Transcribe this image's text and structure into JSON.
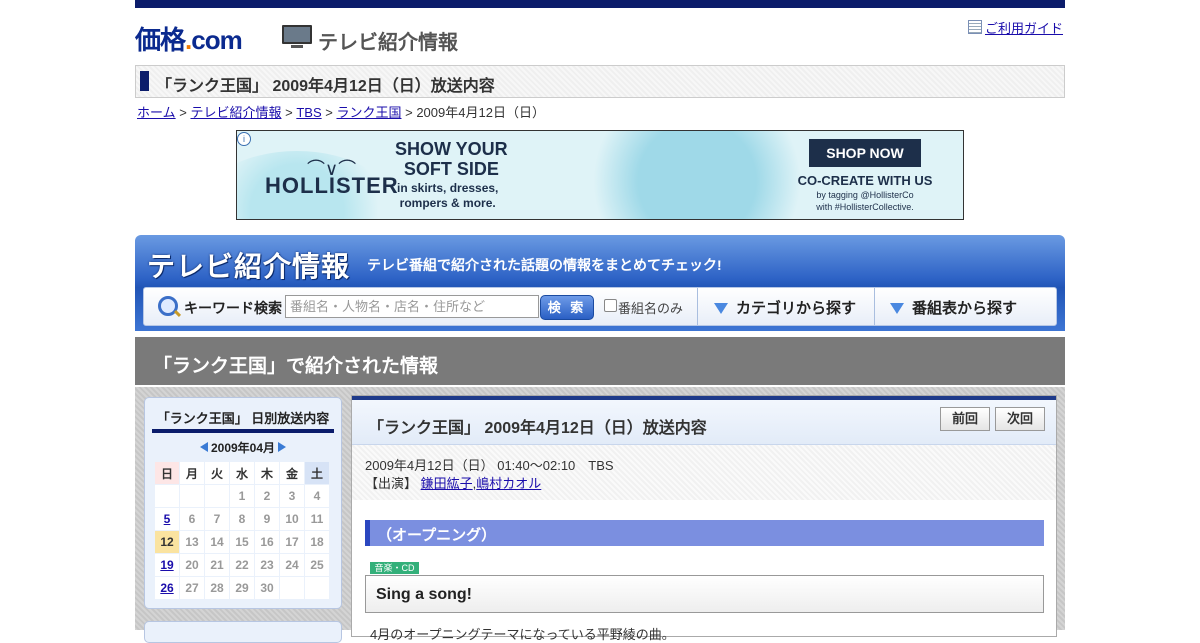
{
  "header": {
    "logo_main": "価格",
    "logo_dot": ".",
    "logo_com": "com",
    "section_title": "テレビ紹介情報",
    "guide_link": "ご利用ガイド"
  },
  "page_title": "「ランク王国」 2009年4月12日（日）放送内容",
  "breadcrumb": [
    {
      "label": "ホーム",
      "link": true
    },
    {
      "label": "テレビ紹介情報",
      "link": true
    },
    {
      "label": "TBS",
      "link": true
    },
    {
      "label": "ランク王国",
      "link": true
    },
    {
      "label": "2009年4月12日（日）",
      "link": false
    }
  ],
  "breadcrumb_sep": ">",
  "ad": {
    "brand": "HOLLISTER",
    "headline_1": "SHOW YOUR",
    "headline_2": "SOFT SIDE",
    "sub_1": "in skirts, dresses,",
    "sub_2": "rompers & more.",
    "cta": "SHOP NOW",
    "cocreate": "CO-CREATE WITH US",
    "tagline_1": "by tagging @HollisterCo",
    "tagline_2": "with #HollisterCollective.",
    "info_icon": "ⓘ"
  },
  "tv_header": {
    "title": "テレビ紹介情報",
    "tagline": "テレビ番組で紹介された話題の情報をまとめてチェック!",
    "search_label": "キーワード検索",
    "search_placeholder": "番組名・人物名・店名・住所など",
    "search_button": "検 索",
    "checkbox_label": "番組名のみ",
    "category_link": "カテゴリから探す",
    "schedule_link": "番組表から探す"
  },
  "section_title": "「ランク王国」で紹介された情報",
  "calendar": {
    "heading": "「ランク王国」 日別放送内容",
    "month": "2009年04月",
    "weekdays": [
      "日",
      "月",
      "火",
      "水",
      "木",
      "金",
      "土"
    ],
    "weeks": [
      [
        "",
        "",
        "",
        "1",
        "2",
        "3",
        "4"
      ],
      [
        "5",
        "6",
        "7",
        "8",
        "9",
        "10",
        "11"
      ],
      [
        "12",
        "13",
        "14",
        "15",
        "16",
        "17",
        "18"
      ],
      [
        "19",
        "20",
        "21",
        "22",
        "23",
        "24",
        "25"
      ],
      [
        "26",
        "27",
        "28",
        "29",
        "30",
        "",
        ""
      ]
    ],
    "linked_days": [
      "5",
      "19",
      "26"
    ],
    "today": "12"
  },
  "main": {
    "title": "「ランク王国」 2009年4月12日（日）放送内容",
    "prev": "前回",
    "next": "次回",
    "broadcast_line": "2009年4月12日（日） 01:40～02:10　TBS",
    "cast_label": "【出演】",
    "cast": [
      "鎌田紘子",
      "嶋村カオル"
    ],
    "cast_sep": ",",
    "segment": "（オープニング）",
    "badge": "音楽・CD",
    "item_title": "Sing a song!",
    "item_desc": "4月のオープニングテーマになっている平野綾の曲。"
  },
  "colors": {
    "navy": "#0b1c6b",
    "tv_blue": "#2155b6",
    "section_gray": "#7a7a7a",
    "segment_blue": "#7b8fe0",
    "badge_green": "#33b07a",
    "today_yellow": "#fae3a0"
  }
}
